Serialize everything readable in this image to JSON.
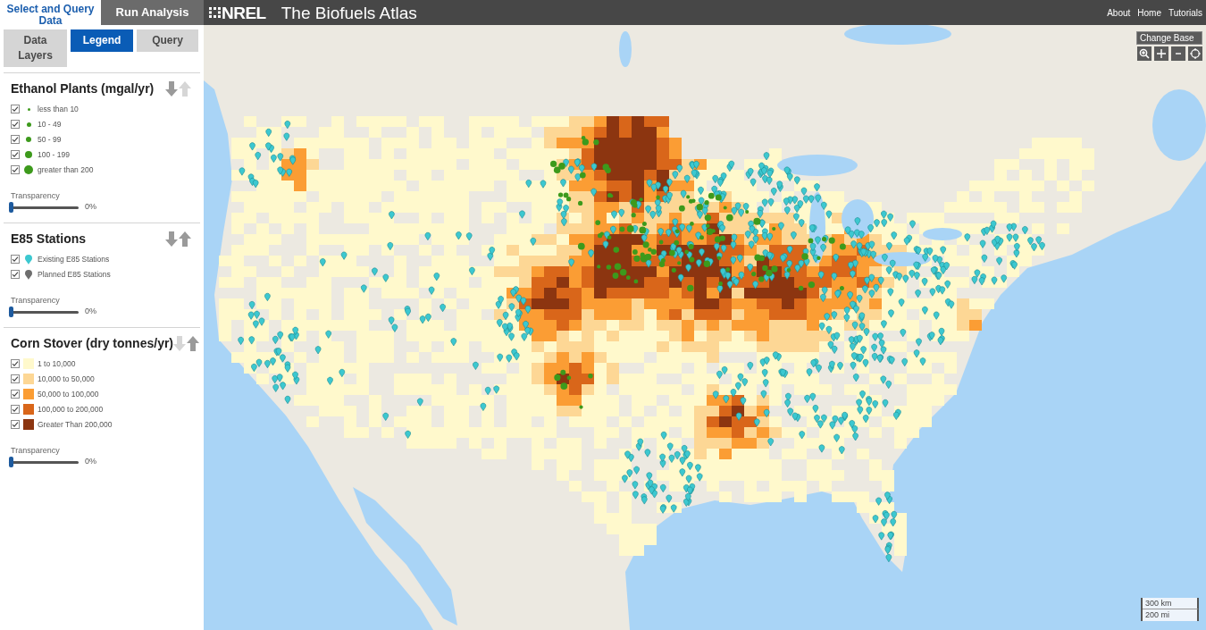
{
  "sidebar": {
    "tabs": [
      {
        "label": "Select and Query Data",
        "selected": true
      },
      {
        "label": "Run Analysis",
        "selected": false
      }
    ],
    "subtabs": [
      {
        "label": "Data Layers",
        "selected": false
      },
      {
        "label": "Legend",
        "selected": true
      },
      {
        "label": "Query",
        "selected": false
      }
    ],
    "layers": [
      {
        "title": "Ethanol Plants (mgal/yr)",
        "move_down": {
          "disabled": false
        },
        "move_up": {
          "disabled": true
        },
        "items": [
          {
            "kind": "dot",
            "label": "less than 10",
            "checked": true
          },
          {
            "kind": "dot",
            "label": "10 - 49",
            "checked": true
          },
          {
            "kind": "dot",
            "label": "50 - 99",
            "checked": true
          },
          {
            "kind": "dot",
            "label": "100 - 199",
            "checked": true
          },
          {
            "kind": "dot",
            "label": "greater than 200",
            "checked": true
          }
        ],
        "transparency": {
          "label": "Transparency",
          "level": 0,
          "reading": "0%"
        }
      },
      {
        "title": "E85 Stations",
        "move_down": {
          "disabled": false
        },
        "move_up": {
          "disabled": false
        },
        "items": [
          {
            "kind": "pin",
            "label": "Existing E85 Stations",
            "checked": true,
            "color": "#3cc8d0"
          },
          {
            "kind": "pin",
            "label": "Planned E85 Stations",
            "checked": true,
            "color": "#6e6e6e"
          }
        ],
        "transparency": {
          "label": "Transparency",
          "level": 0,
          "reading": "0%"
        }
      },
      {
        "title": "Corn Stover (dry tonnes/yr)",
        "move_down": {
          "disabled": true
        },
        "move_up": {
          "disabled": false
        },
        "items": [
          {
            "kind": "swatch",
            "label": "1 to 10,000",
            "checked": true,
            "color": "#fff9cc"
          },
          {
            "kind": "swatch",
            "label": "10,000 to 50,000",
            "checked": true,
            "color": "#fdd795"
          },
          {
            "kind": "swatch",
            "label": "50,000 to 100,000",
            "checked": true,
            "color": "#fb9d34"
          },
          {
            "kind": "swatch",
            "label": "100,000 to 200,000",
            "checked": true,
            "color": "#d9661a"
          },
          {
            "kind": "swatch",
            "label": "Greater Than 200,000",
            "checked": true,
            "color": "#8c3510"
          }
        ],
        "transparency": {
          "label": "Transparency",
          "level": 0,
          "reading": "0%"
        }
      }
    ]
  },
  "header": {
    "logo_text": "NREL",
    "title": "The Biofuels Atlas",
    "links": [
      "About",
      "Home",
      "Tutorials"
    ]
  },
  "map": {
    "change_base": "Change Base",
    "scale": [
      "300 km",
      "200 mi"
    ]
  }
}
